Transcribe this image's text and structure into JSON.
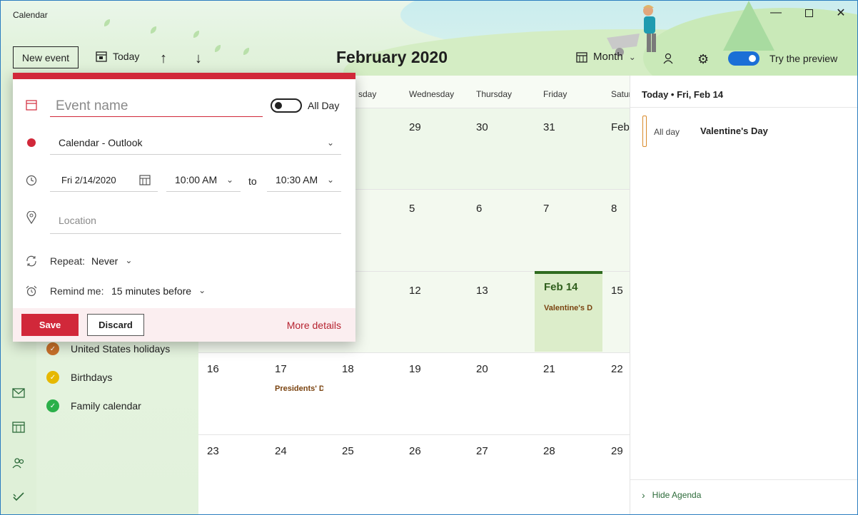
{
  "window": {
    "title": "Calendar"
  },
  "toolbar": {
    "new_event": "New event",
    "today": "Today",
    "month_title": "February 2020",
    "view": "Month",
    "try_preview": "Try the preview"
  },
  "day_names": [
    "Wednesday",
    "Thursday",
    "Friday",
    "Satur",
    "sday"
  ],
  "weeks": [
    [
      "29",
      "30",
      "31",
      "Feb"
    ],
    [
      "5",
      "6",
      "7",
      "8"
    ],
    [
      "12",
      "13",
      "Feb 14",
      "15"
    ],
    [
      "16",
      "17",
      "18",
      "19",
      "20",
      "21",
      "22"
    ],
    [
      "23",
      "24",
      "25",
      "26",
      "27",
      "28",
      "29"
    ]
  ],
  "events": {
    "valentines_short": "Valentine's D",
    "presidents_short": "Presidents' D"
  },
  "calendars": [
    {
      "label": "United States holidays",
      "color": "#c8702a"
    },
    {
      "label": "Birthdays",
      "color": "#e6b800"
    },
    {
      "label": "Family calendar",
      "color": "#2bb04a"
    }
  ],
  "agenda": {
    "header": "Today • Fri, Feb 14",
    "all_day": "All day",
    "event_title": "Valentine's Day",
    "hide": "Hide Agenda"
  },
  "popup": {
    "event_name_placeholder": "Event name",
    "all_day": "All Day",
    "calendar": "Calendar - Outlook",
    "date": "Fri 2/14/2020",
    "start_time": "10:00 AM",
    "to": "to",
    "end_time": "10:30 AM",
    "location_placeholder": "Location",
    "repeat_label": "Repeat:",
    "repeat_value": "Never",
    "remind_label": "Remind me:",
    "remind_value": "15 minutes before",
    "save": "Save",
    "discard": "Discard",
    "more_details": "More details",
    "accent": "#d1283a"
  }
}
